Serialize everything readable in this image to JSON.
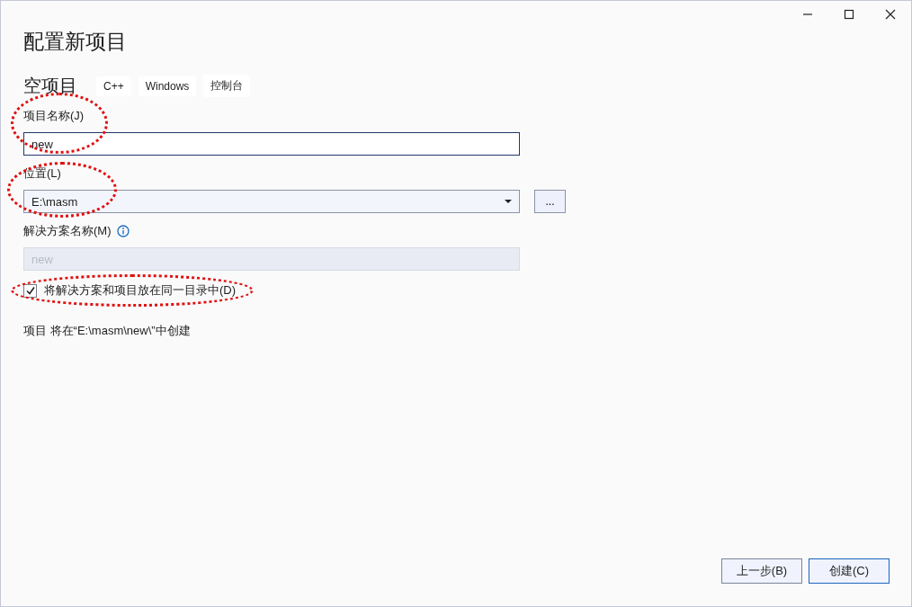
{
  "title": "配置新项目",
  "template": {
    "name": "空项目",
    "tags": [
      "C++",
      "Windows",
      "控制台"
    ]
  },
  "fields": [
    {
      "kind": "text",
      "label": "项目名称(J)",
      "value": "new",
      "focused": true,
      "disabled": false,
      "circled": true
    },
    {
      "kind": "dropdown",
      "label": "位置(L)",
      "value": "E:\\masm",
      "browse": "...",
      "circled": true
    },
    {
      "kind": "text",
      "label": "解决方案名称(M)",
      "value": "new",
      "info": true,
      "focused": false,
      "disabled": true
    }
  ],
  "same_dir": {
    "label": "将解决方案和项目放在同一目录中(D)",
    "checked": true,
    "circled": true
  },
  "summary": "项目 将在“E:\\masm\\new\\”中创建",
  "buttons": [
    {
      "label": "上一步(B)",
      "primary": false
    },
    {
      "label": "创建(C)",
      "primary": true
    }
  ]
}
